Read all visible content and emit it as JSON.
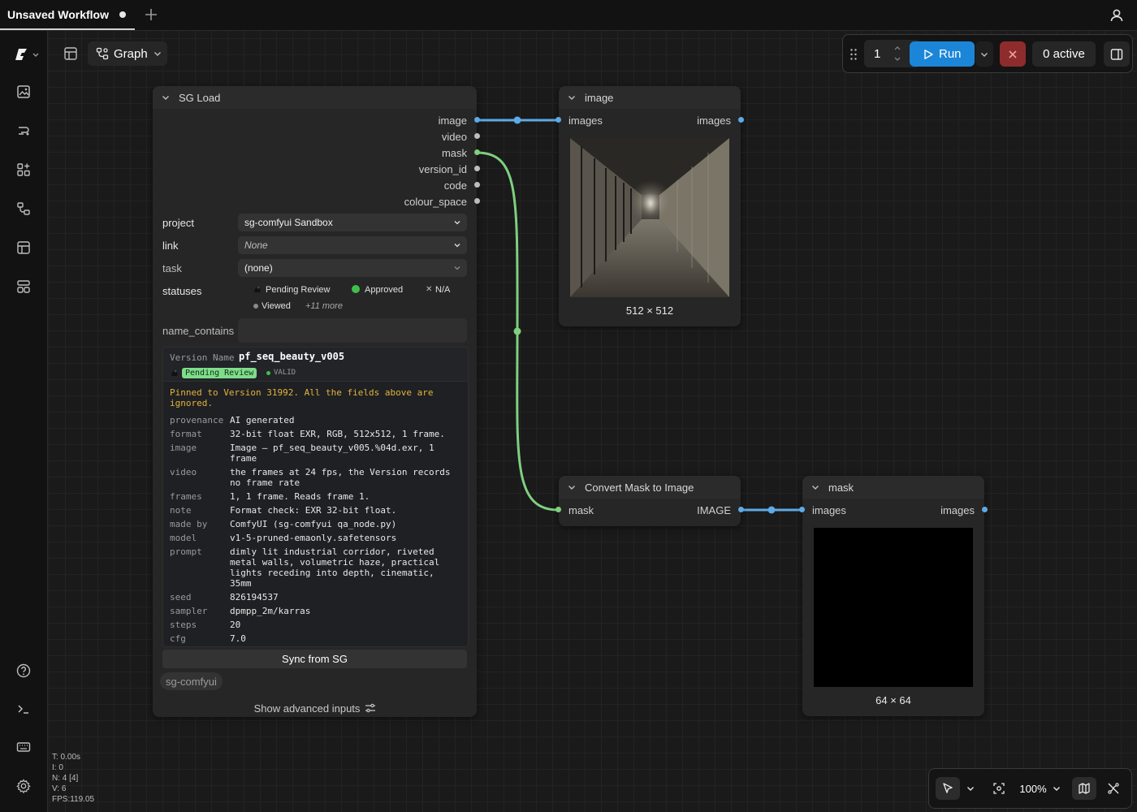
{
  "tabs": [
    {
      "title": "Unsaved Workflow",
      "modified": true
    }
  ],
  "toolbar": {
    "graph_label": "Graph"
  },
  "runbar": {
    "queue_count": "1",
    "run_label": "Run",
    "active_label": "0 active"
  },
  "colors": {
    "accent": "#1b86d8",
    "image_link": "#5ea9e6",
    "mask_link": "#7fcf7f",
    "stop": "#8e2c2c",
    "pending_badge": "#7fdd8a",
    "warning_text": "#e2b33c"
  },
  "nodes": {
    "sg_load": {
      "title": "SG Load",
      "outputs": [
        "image",
        "video",
        "mask",
        "version_id",
        "code",
        "colour_space"
      ],
      "widgets": {
        "project": {
          "label": "project",
          "value": "sg-comfyui Sandbox"
        },
        "link": {
          "label": "link",
          "value": "None"
        },
        "task": {
          "label": "task",
          "value": "(none)"
        },
        "statuses": {
          "label": "statuses",
          "items": [
            "Pending Review",
            "Approved",
            "N/A",
            "Viewed"
          ],
          "more": "+11 more"
        },
        "name_contains": {
          "label": "name_contains",
          "value": ""
        }
      },
      "info": {
        "version_name_key": "Version Name",
        "version_name": "pf_seq_beauty_v005",
        "status_badge": "Pending Review",
        "valid": "VALID",
        "warning": "Pinned to Version 31992. All the fields above are\nignored.",
        "rows": [
          {
            "key": "provenance",
            "value": "AI generated"
          },
          {
            "key": "format",
            "value": "32-bit float EXR, RGB, 512x512, 1 frame."
          },
          {
            "key": "image",
            "value": "Image — pf_seq_beauty_v005.%04d.exr, 1\nframe"
          },
          {
            "key": "video",
            "value": "the frames at 24 fps, the Version records\nno frame rate"
          },
          {
            "key": "frames",
            "value": "1, 1 frame. Reads frame 1."
          },
          {
            "key": "note",
            "value": "Format check: EXR 32-bit float."
          },
          {
            "key": "made by",
            "value": "ComfyUI (sg-comfyui qa_node.py)"
          },
          {
            "key": "model",
            "value": "v1-5-pruned-emaonly.safetensors"
          },
          {
            "key": "prompt",
            "value": "dimly lit industrial corridor, riveted\nmetal walls, volumetric haze, practical\nlights receding into depth, cinematic,\n35mm"
          },
          {
            "key": "seed",
            "value": "826194537"
          },
          {
            "key": "sampler",
            "value": "dpmpp_2m/karras"
          },
          {
            "key": "steps",
            "value": "20"
          },
          {
            "key": "cfg",
            "value": "7.0"
          }
        ]
      },
      "sync_label": "Sync from SG",
      "tag": "sg-comfyui",
      "advanced_label": "Show advanced inputs"
    },
    "image_preview": {
      "title": "image",
      "input": "images",
      "output": "images",
      "caption": "512 × 512"
    },
    "convert": {
      "title": "Convert Mask to Image",
      "input": "mask",
      "output": "IMAGE"
    },
    "mask_preview": {
      "title": "mask",
      "input": "images",
      "output": "images",
      "caption": "64 × 64"
    }
  },
  "stats": [
    "T: 0.00s",
    "I: 0",
    "N: 4 [4]",
    "V: 6",
    "FPS:119.05"
  ],
  "canvas_controls": {
    "zoom": "100%"
  }
}
